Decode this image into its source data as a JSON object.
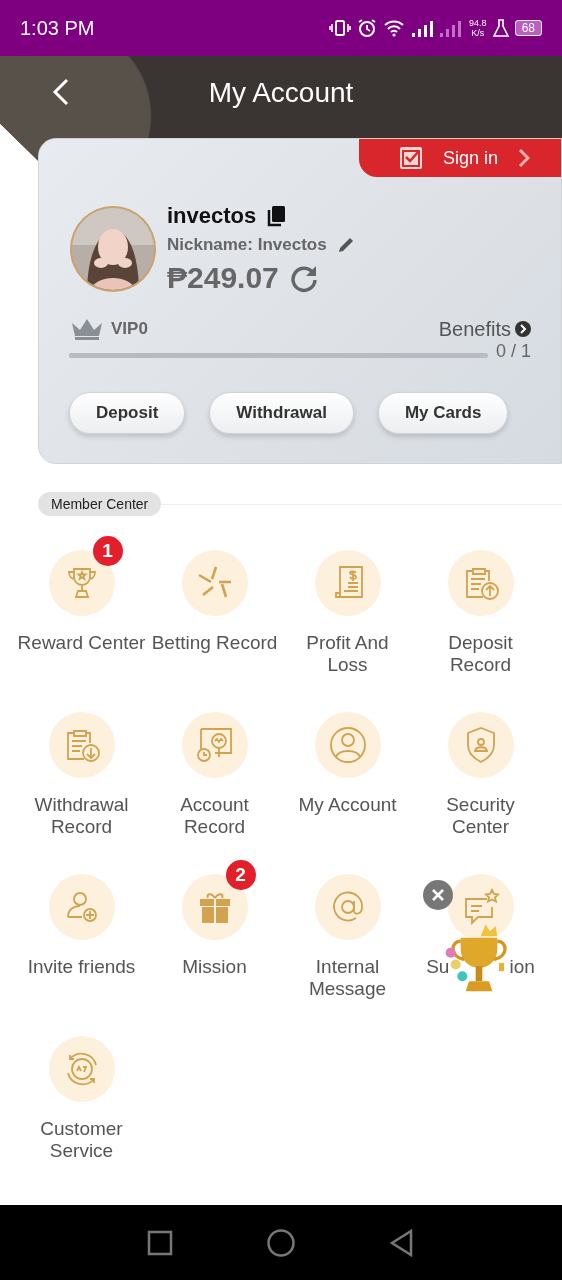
{
  "status_bar": {
    "time": "1:03 PM",
    "speed_value": "94.8",
    "speed_unit": "K/s",
    "battery": "68"
  },
  "header": {
    "title": "My Account"
  },
  "account_card": {
    "sign_in": "Sign in",
    "username": "invectos",
    "nickname": "Nickname: Invectos",
    "balance": "₱249.07",
    "vip": "VIP0",
    "benefits": "Benefits",
    "progress": "0 / 1",
    "buttons": [
      "Deposit",
      "Withdrawal",
      "My Cards"
    ]
  },
  "member_center": {
    "title": "Member Center",
    "items": [
      {
        "label": "Reward Center",
        "badge": "1"
      },
      {
        "label": "Betting Record"
      },
      {
        "label": "Profit And Loss"
      },
      {
        "label": "Deposit Record"
      },
      {
        "label": "Withdrawal Record"
      },
      {
        "label": "Account Record"
      },
      {
        "label": "My Account"
      },
      {
        "label": "Security Center"
      },
      {
        "label": "Invite friends"
      },
      {
        "label": "Mission",
        "badge": "2"
      },
      {
        "label": "Internal Message"
      },
      {
        "label_fragments": [
          "Su",
          "ion"
        ]
      },
      {
        "label": "Customer Service"
      }
    ]
  }
}
